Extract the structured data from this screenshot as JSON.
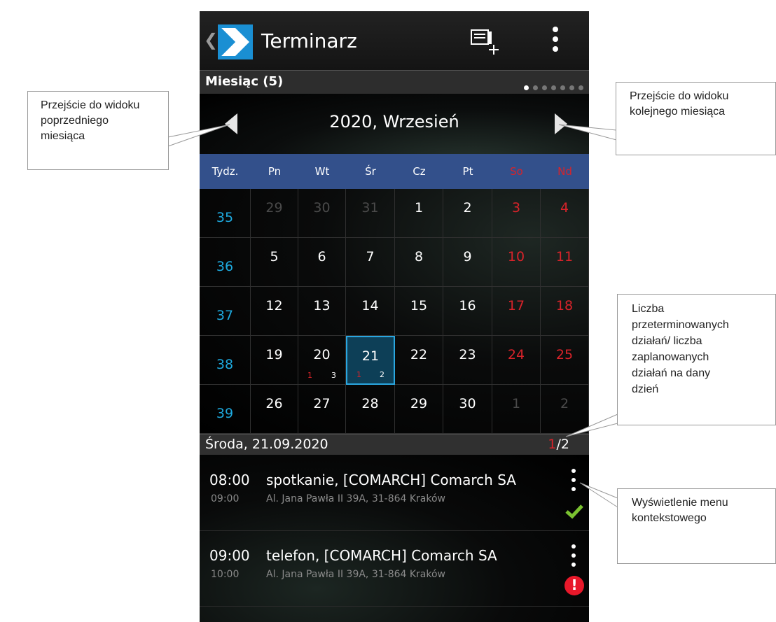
{
  "app": {
    "title": "Terminarz",
    "back_icon": "chevron-left-icon",
    "logo_icon": "app-logo-icon",
    "add_icon": "add-task-icon",
    "menu_icon": "overflow-menu-icon"
  },
  "section": {
    "title": "Miesiąc (5)",
    "pages": 7,
    "active_page": 1
  },
  "month_nav": {
    "label": "2020, Wrzesień"
  },
  "calendar": {
    "headers": [
      "Tydz.",
      "Pn",
      "Wt",
      "Śr",
      "Cz",
      "Pt",
      "So",
      "Nd"
    ],
    "weeks": [
      {
        "week": "35",
        "days": [
          {
            "n": "29",
            "other": true
          },
          {
            "n": "30",
            "other": true
          },
          {
            "n": "31",
            "other": true
          },
          {
            "n": "1"
          },
          {
            "n": "2"
          },
          {
            "n": "3",
            "weekend": true
          },
          {
            "n": "4",
            "weekend": true
          }
        ]
      },
      {
        "week": "36",
        "days": [
          {
            "n": "5"
          },
          {
            "n": "6"
          },
          {
            "n": "7"
          },
          {
            "n": "8"
          },
          {
            "n": "9"
          },
          {
            "n": "10",
            "weekend": true
          },
          {
            "n": "11",
            "weekend": true
          }
        ]
      },
      {
        "week": "37",
        "days": [
          {
            "n": "12"
          },
          {
            "n": "13"
          },
          {
            "n": "14"
          },
          {
            "n": "15"
          },
          {
            "n": "16"
          },
          {
            "n": "17",
            "weekend": true
          },
          {
            "n": "18",
            "weekend": true
          }
        ]
      },
      {
        "week": "38",
        "days": [
          {
            "n": "19"
          },
          {
            "n": "20",
            "overdue": "1",
            "planned": "3"
          },
          {
            "n": "21",
            "overdue": "1",
            "planned": "2",
            "selected": true
          },
          {
            "n": "22"
          },
          {
            "n": "23"
          },
          {
            "n": "24",
            "weekend": true
          },
          {
            "n": "25",
            "weekend": true
          }
        ]
      },
      {
        "week": "39",
        "days": [
          {
            "n": "26"
          },
          {
            "n": "27"
          },
          {
            "n": "28"
          },
          {
            "n": "29"
          },
          {
            "n": "30"
          },
          {
            "n": "1",
            "other": true
          },
          {
            "n": "2",
            "other": true
          }
        ]
      }
    ]
  },
  "day": {
    "label": "Środa, 21.09.2020",
    "overdue": "1",
    "total": "/2"
  },
  "events": [
    {
      "start": "08:00",
      "title": "spotkanie, [COMARCH] Comarch SA",
      "end": "09:00",
      "address": "Al. Jana Pawła II 39A, 31-864 Kraków",
      "status_icon": "check-icon"
    },
    {
      "start": "09:00",
      "title": "telefon, [COMARCH] Comarch SA",
      "end": "10:00",
      "address": "Al. Jana Pawła II 39A, 31-864 Kraków",
      "status_icon": "warning-icon",
      "status_text": "!"
    }
  ],
  "callouts": {
    "prev": [
      "Przejście do widoku",
      "poprzedniego",
      "miesiąca"
    ],
    "next": [
      "Przejście do widoku",
      "kolejnego miesiąca"
    ],
    "count": [
      "Liczba",
      "przeterminowanych",
      "działań/ liczba",
      "zaplanowanych",
      "działań na dany",
      "dzień"
    ],
    "menu": [
      "Wyświetlenie menu",
      "kontekstowego"
    ]
  },
  "colors": {
    "header_blue": "#33508b",
    "week_number": "#1eaadf",
    "weekend": "#d8232a",
    "other_month": "#4a4a4a",
    "selected_border": "#2aa6df",
    "check": "#7ac230",
    "warning": "#e8182a"
  }
}
